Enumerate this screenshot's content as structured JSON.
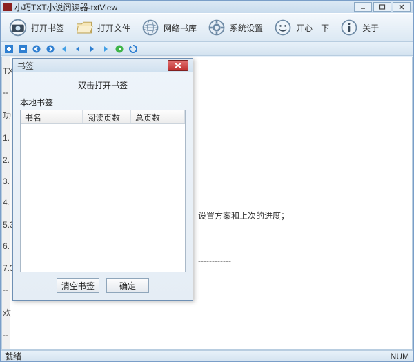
{
  "title": "小巧TXT小说阅读器-txtView",
  "toolbar": [
    {
      "label": "打开书签"
    },
    {
      "label": "打开文件"
    },
    {
      "label": "网络书库"
    },
    {
      "label": "系统设置"
    },
    {
      "label": "开心一下"
    },
    {
      "label": "关于"
    }
  ],
  "sidebar_markers": [
    "TX",
    "--",
    "功",
    "1.",
    "2.",
    "3.",
    "4.",
    "5.3",
    "6.",
    "7.3",
    "--",
    "欢",
    "--"
  ],
  "reader_line": "设置方案和上次的进度；",
  "reader_dashes": "------------",
  "status_left": "就绪",
  "status_right": "NUM",
  "dialog": {
    "title": "书签",
    "subtitle": "双击打开书签",
    "group": "本地书签",
    "cols": [
      "书名",
      "阅读页数",
      "总页数"
    ],
    "btn_clear": "清空书签",
    "btn_ok": "确定"
  }
}
